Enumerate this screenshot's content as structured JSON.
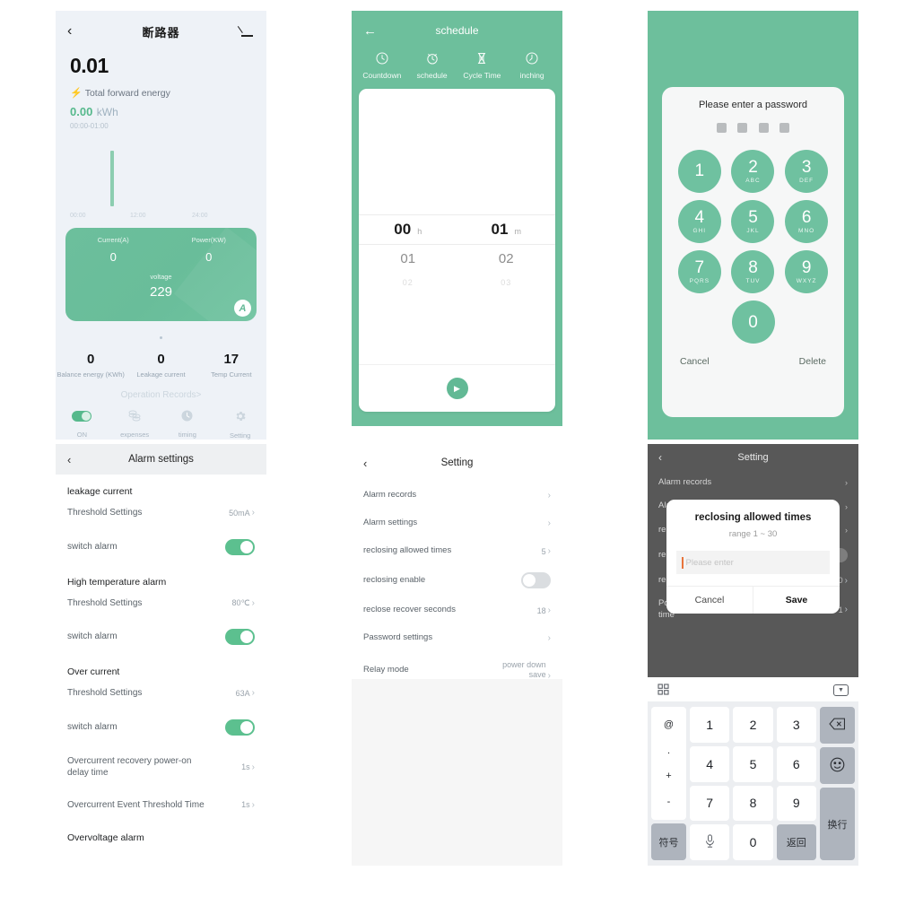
{
  "device": {
    "title": "断路器",
    "back_icon": "chevron-left-icon",
    "edit_icon": "pencil-icon",
    "big_number": "0.01",
    "total_forward_energy_label": "Total forward energy",
    "bolt_icon": "lightning-icon",
    "energy_value": "0.00",
    "energy_unit": "kWh",
    "energy_range": "00:00-01:00",
    "chart": {
      "x_ticks": [
        "00:00",
        "12:00",
        "24:00"
      ]
    },
    "card": {
      "current_label": "Current(A)",
      "current_value": "0",
      "power_label": "Power(KW)",
      "power_value": "0",
      "voltage_label": "voltage",
      "voltage_value": "229",
      "phase_badge": "A"
    },
    "stats": [
      {
        "value": "0",
        "label": "Balance energy (KWh)"
      },
      {
        "value": "0",
        "label": "Leakage current"
      },
      {
        "value": "17",
        "label": "Temp Current"
      }
    ],
    "operation_records": "Operation Records>",
    "tabs": [
      {
        "label": "ON",
        "icon": "toggle-on-icon"
      },
      {
        "label": "expenses",
        "icon": "coins-icon"
      },
      {
        "label": "timing",
        "icon": "clock-icon"
      },
      {
        "label": "Setting",
        "icon": "gear-icon"
      }
    ]
  },
  "alarm": {
    "title": "Alarm settings",
    "back_icon": "chevron-left-icon",
    "groups": [
      {
        "title": "leakage current",
        "rows": [
          {
            "label": "Threshold Settings",
            "value": "50mA",
            "type": "value"
          },
          {
            "label": "switch alarm",
            "type": "switch",
            "on": true
          }
        ]
      },
      {
        "title": "High temperature alarm",
        "rows": [
          {
            "label": "Threshold Settings",
            "value": "80℃",
            "type": "value"
          },
          {
            "label": "switch alarm",
            "type": "switch",
            "on": true
          }
        ]
      },
      {
        "title": "Over current",
        "rows": [
          {
            "label": "Threshold Settings",
            "value": "63A",
            "type": "value"
          },
          {
            "label": "switch alarm",
            "type": "switch",
            "on": true
          },
          {
            "label": "Overcurrent recovery power-on delay time",
            "value": "1s",
            "type": "value"
          },
          {
            "label": "Overcurrent Event Threshold Time",
            "value": "1s",
            "type": "value"
          }
        ]
      },
      {
        "title": "Overvoltage alarm",
        "rows": []
      }
    ]
  },
  "schedule": {
    "title": "schedule",
    "back_icon": "arrow-left-icon",
    "tabs": [
      {
        "label": "Countdown",
        "icon": "clock-icon"
      },
      {
        "label": "schedule",
        "icon": "alarm-clock-icon"
      },
      {
        "label": "Cycle Time",
        "icon": "hourglass-icon"
      },
      {
        "label": "inching",
        "icon": "stopwatch-icon"
      }
    ],
    "picker": {
      "hour_value": "00",
      "hour_unit": "h",
      "minute_value": "01",
      "minute_unit": "m",
      "hour_next": "01",
      "minute_next": "02",
      "hour_next2": "02",
      "minute_next2": "03"
    },
    "play_icon": "play-icon"
  },
  "setting": {
    "title": "Setting",
    "back_icon": "chevron-left-icon",
    "rows": [
      {
        "label": "Alarm records",
        "value": "",
        "type": "link"
      },
      {
        "label": "Alarm settings",
        "value": "",
        "type": "link"
      },
      {
        "label": "reclosing allowed times",
        "value": "5",
        "type": "value"
      },
      {
        "label": "reclosing enable",
        "type": "switch",
        "on": false
      },
      {
        "label": "reclose recover seconds",
        "value": "18",
        "type": "value"
      },
      {
        "label": "Password settings",
        "value": "",
        "type": "link"
      },
      {
        "label": "Relay mode",
        "value": "power down save",
        "type": "value"
      }
    ]
  },
  "password": {
    "title": "Please enter a password",
    "dot_count": 4,
    "keys": [
      [
        {
          "num": "1",
          "letters": ""
        },
        {
          "num": "2",
          "letters": "ABC"
        },
        {
          "num": "3",
          "letters": "DEF"
        }
      ],
      [
        {
          "num": "4",
          "letters": "GHI"
        },
        {
          "num": "5",
          "letters": "JKL"
        },
        {
          "num": "6",
          "letters": "MNO"
        }
      ],
      [
        {
          "num": "7",
          "letters": "PQRS"
        },
        {
          "num": "8",
          "letters": "TUV"
        },
        {
          "num": "9",
          "letters": "WXYZ"
        }
      ]
    ],
    "zero_key": {
      "num": "0",
      "letters": ""
    },
    "cancel_label": "Cancel",
    "delete_label": "Delete"
  },
  "dialog_screen": {
    "title": "Setting",
    "back_icon": "chevron-left-icon",
    "bg_rows": [
      {
        "label": "Alarm records",
        "value": "",
        "type": "link"
      },
      {
        "label": "Alarm settings",
        "value": "",
        "type": "link"
      },
      {
        "label": "reclosing allowed times",
        "value": "",
        "type": "link"
      },
      {
        "label": "reclosing enable",
        "type": "switch",
        "on": false
      },
      {
        "label": "reclose recover seconds",
        "value": "30",
        "type": "value"
      },
      {
        "label": "Power-on delay power-on time",
        "value": "1",
        "type": "value"
      }
    ],
    "modal": {
      "title": "reclosing allowed times",
      "subtitle": "range 1 ~ 30",
      "input_value": "",
      "input_placeholder": "Please enter",
      "cancel_label": "Cancel",
      "save_label": "Save"
    }
  },
  "keyboard": {
    "grid_icon": "grid-icon",
    "collapse_icon": "chevron-down-box-icon",
    "left_symbols": [
      "@",
      ".",
      "+",
      "-"
    ],
    "digits_rows": [
      [
        "1",
        "2",
        "3"
      ],
      [
        "4",
        "5",
        "6"
      ],
      [
        "7",
        "8",
        "9"
      ]
    ],
    "symbol_key": "符号",
    "space_key_icon": "microphone-icon",
    "zero_key": "0",
    "return_key": "返回",
    "backspace_icon": "backspace-icon",
    "emoji_icon": "smiley-icon",
    "newline_key": "换行"
  },
  "colors": {
    "brand_green": "#6dbf9c",
    "key_green": "#6fc1a0",
    "toggle_green": "#5cc08f",
    "device_bg": "#eef2f7",
    "dim_overlay": "#585858",
    "caret_orange": "#e8743b"
  }
}
